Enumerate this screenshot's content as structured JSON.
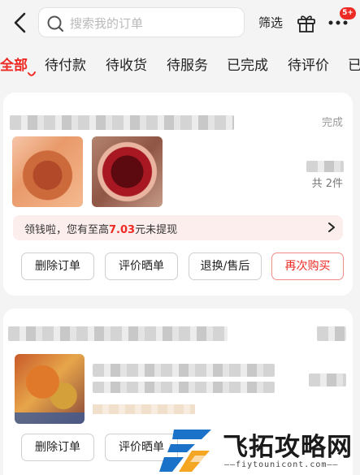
{
  "header": {
    "search_placeholder": "搜索我的订单",
    "filter_label": "筛选",
    "more_badge": "5+"
  },
  "tabs": [
    {
      "label": "全部",
      "active": true
    },
    {
      "label": "待付款"
    },
    {
      "label": "待收货"
    },
    {
      "label": "待服务"
    },
    {
      "label": "已完成"
    },
    {
      "label": "待评价"
    },
    {
      "label": "已"
    }
  ],
  "orders": [
    {
      "status": "完成",
      "item_count": "共 2件",
      "promo": {
        "prefix": "领钱啦，您有至高",
        "amount": "7.03",
        "suffix": "元未提现"
      },
      "buttons": [
        "删除订单",
        "评价晒单",
        "退换/售后",
        "再次购买"
      ]
    },
    {
      "buttons": [
        "删除订单",
        "评价晒单"
      ]
    }
  ],
  "colors": {
    "accent": "#ee2a24",
    "promo_bg": "#fdeeee",
    "watermark_blue": "#1a73c9",
    "watermark_orange": "#f5a623"
  },
  "watermark": {
    "name": "飞拓攻略网",
    "url": "fiytounicont.com"
  }
}
